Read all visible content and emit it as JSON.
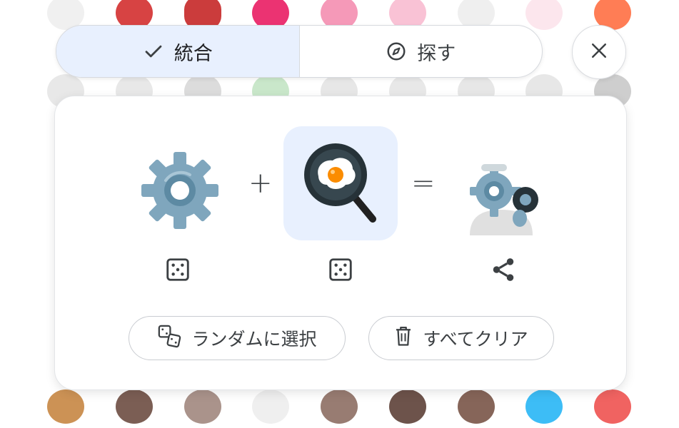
{
  "toggle": {
    "merge_label": "統合",
    "explore_label": "探す",
    "active": "merge"
  },
  "combination": {
    "left_emoji": "gear",
    "right_emoji": "cooking",
    "result_emoji": "gear-chef-cooking",
    "plus_symbol": "+",
    "equals_symbol": "="
  },
  "actions": {
    "random_label": "ランダムに選択",
    "clear_label": "すべてクリア"
  },
  "icons": {
    "check": "check-icon",
    "compass": "compass-icon",
    "close": "close-icon",
    "dice": "dice-icon",
    "share": "share-icon",
    "dice_pair": "dice-pair-icon",
    "trash": "trash-icon"
  },
  "colors": {
    "active_segment": "#e8f0fe",
    "selected_slot": "#e8f0fe",
    "gear": "#7fa6bd",
    "text": "#3c4043"
  }
}
